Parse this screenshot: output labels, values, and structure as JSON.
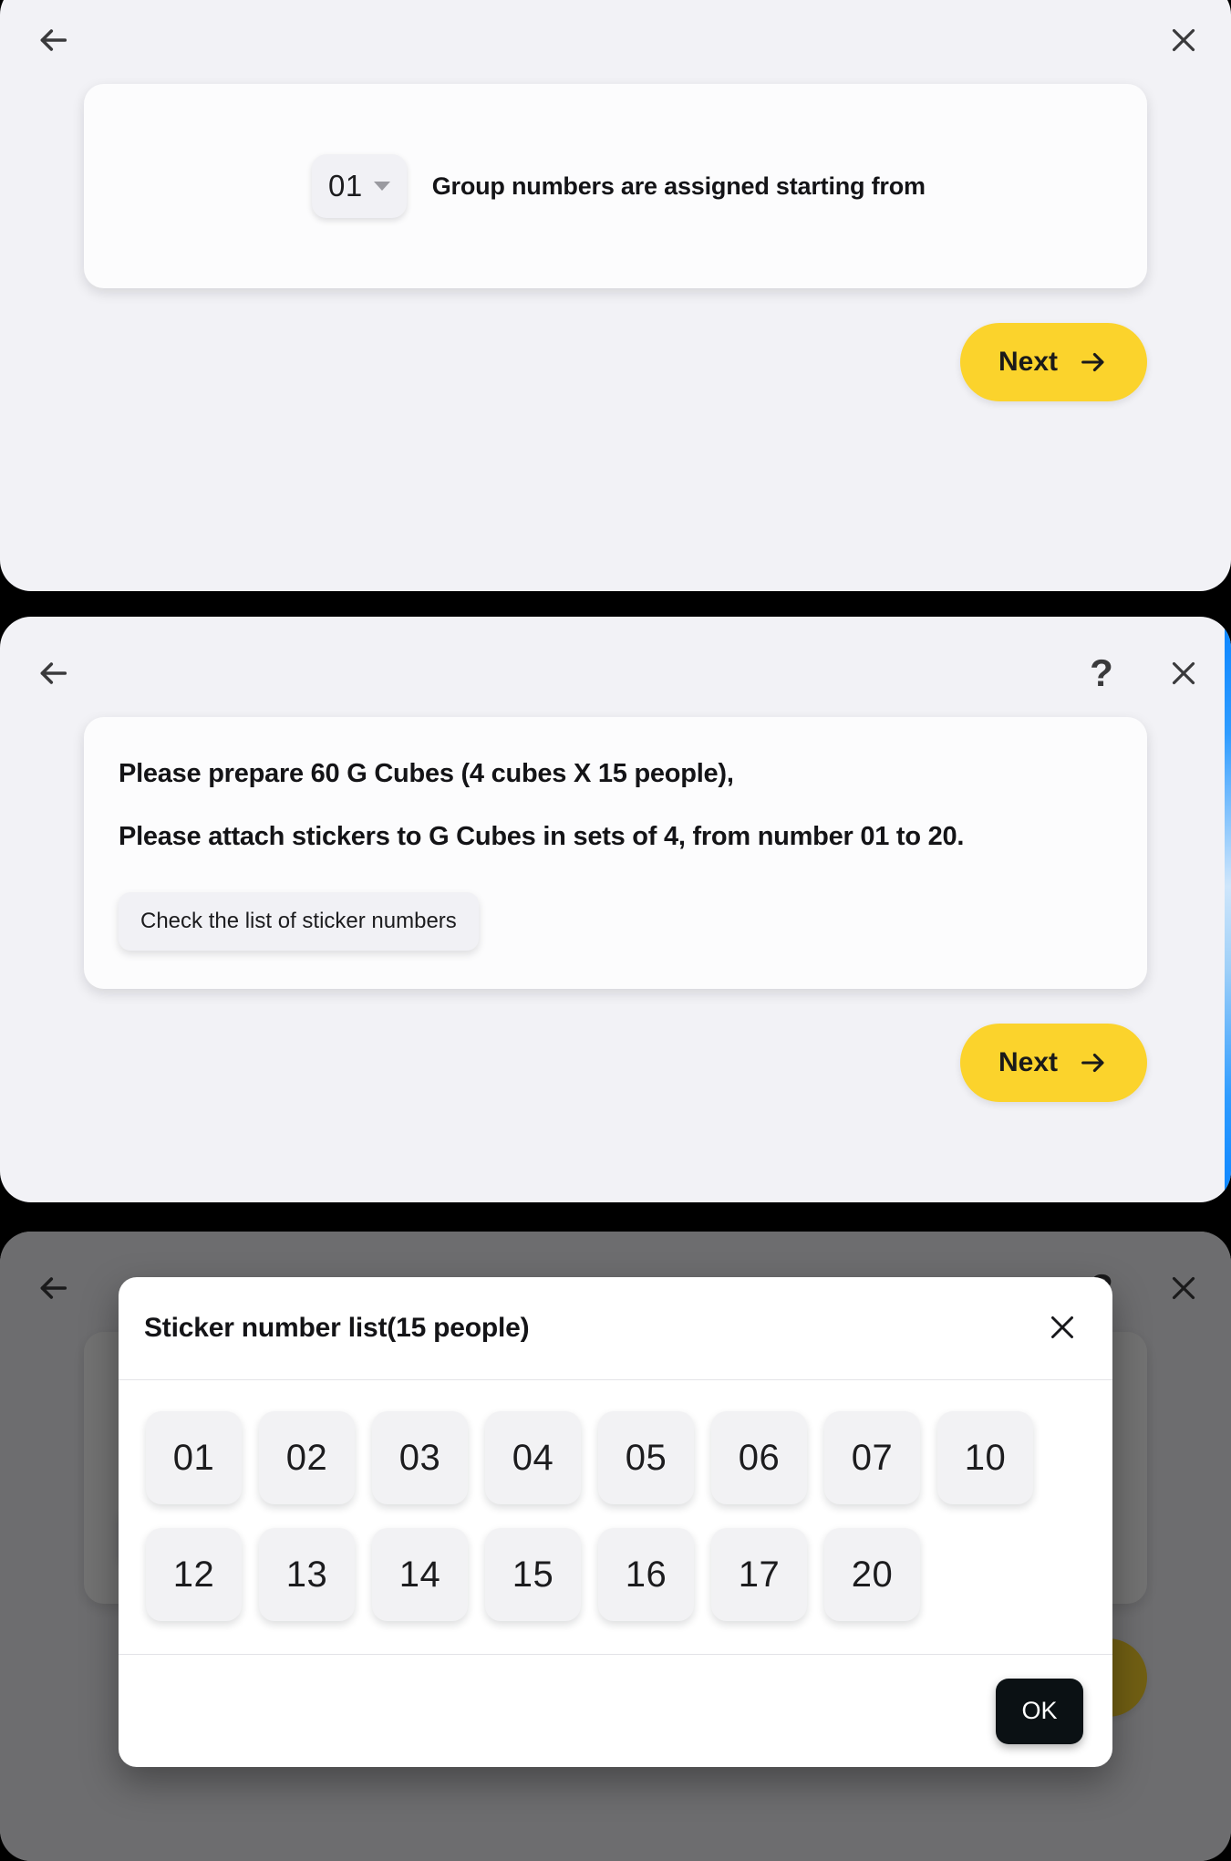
{
  "panels": {
    "group_setup": {
      "back_icon": "arrow-left-icon",
      "close_icon": "close-icon",
      "group_select_value": "01",
      "group_select_caret": "chevron-down-icon",
      "group_label": "Group numbers are assigned starting from",
      "next_label": "Next",
      "next_icon": "arrow-right-icon"
    },
    "prepare_cubes": {
      "back_icon": "arrow-left-icon",
      "help_icon": "question-mark-icon",
      "close_icon": "close-icon",
      "line_1": "Please prepare 60 G Cubes (4 cubes X 15 people),",
      "line_2": "Please attach stickers to G Cubes in sets of 4, from number 01 to 20.",
      "check_list_label": "Check the list of sticker numbers",
      "next_label": "Next",
      "next_icon": "arrow-right-icon"
    },
    "sticker_list": {
      "back_icon": "arrow-left-icon",
      "help_icon": "question-mark-icon",
      "close_icon": "close-icon",
      "modal": {
        "title": "Sticker number list(15 people)",
        "close_icon": "close-icon",
        "rows": [
          [
            "01",
            "02",
            "03",
            "04",
            "05",
            "06",
            "07",
            "10"
          ],
          [
            "12",
            "13",
            "14",
            "15",
            "16",
            "17",
            "20"
          ]
        ],
        "ok_label": "OK"
      }
    }
  },
  "colors": {
    "accent_yellow": "#fbd32c",
    "panel_bg": "#f2f2f6",
    "card_bg": "#fcfcfd",
    "chip_bg": "#f2f2f4",
    "ok_black": "#0b1114",
    "scroll_blue": "#0a84ff"
  }
}
